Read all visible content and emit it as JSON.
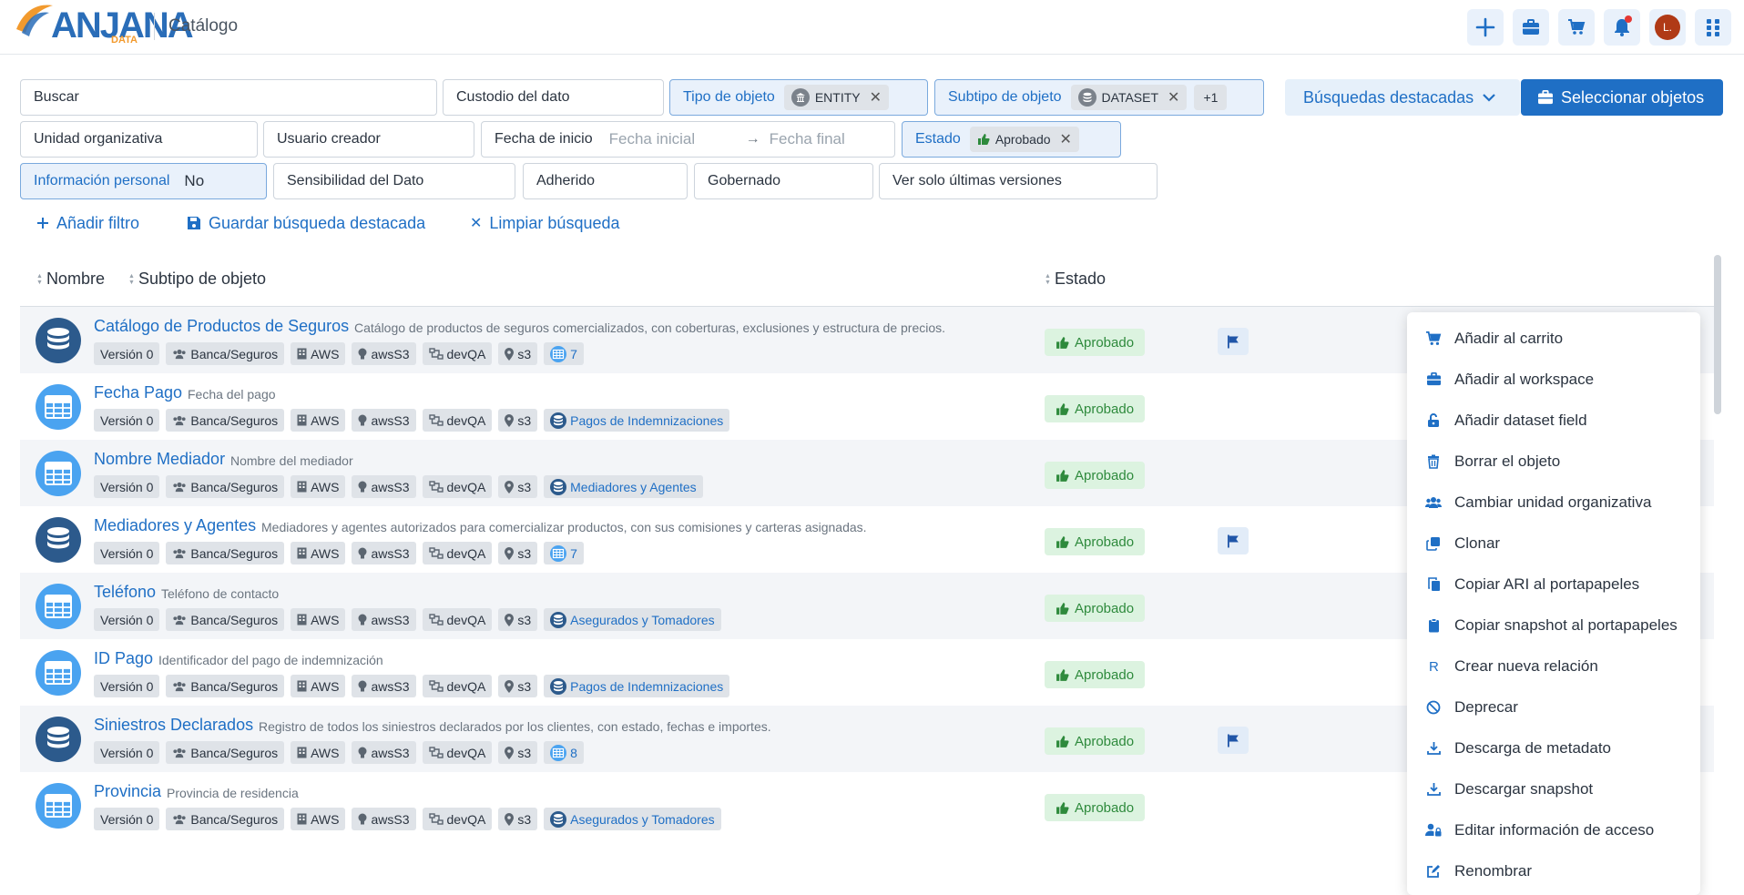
{
  "header": {
    "logo_text": "ANJANA",
    "logo_sub": "DATA",
    "title": "Catálogo",
    "avatar_initial": "L.",
    "colors": {
      "accent": "#1f6fc5",
      "avatar": "#b03a16",
      "notification": "#e53935"
    }
  },
  "filters": {
    "search_label": "Buscar",
    "custodian_label": "Custodio del dato",
    "object_type": {
      "label": "Tipo de objeto",
      "chip": "ENTITY"
    },
    "object_subtype": {
      "label": "Subtipo de objeto",
      "chip": "DATASET",
      "more": "+1"
    },
    "featured_searches": "Búsquedas destacadas",
    "select_objects": "Seleccionar objetos",
    "org_unit_label": "Unidad organizativa",
    "creator_label": "Usuario creador",
    "start_date": {
      "label": "Fecha de inicio",
      "from_placeholder": "Fecha inicial",
      "to_placeholder": "Fecha final"
    },
    "state": {
      "label": "Estado",
      "chip": "Aprobado"
    },
    "personal_info": {
      "label": "Información personal",
      "value": "No"
    },
    "sensitivity_label": "Sensibilidad del Dato",
    "adhered_label": "Adherido",
    "governed_label": "Gobernado",
    "latest_versions_label": "Ver solo últimas versiones"
  },
  "actions": {
    "add_filter": "Añadir filtro",
    "save_search": "Guardar búsqueda destacada",
    "clear_search": "Limpiar búsqueda"
  },
  "table": {
    "columns": {
      "name": "Nombre",
      "subtype": "Subtipo de objeto",
      "state": "Estado"
    },
    "rows": [
      {
        "kind": "dataset",
        "title": "Catálogo de Productos de Seguros",
        "desc": "Catálogo de productos de seguros comercializados, con coberturas, exclusiones y estructura de precios.",
        "version": "Versión 0",
        "org": "Banca/Seguros",
        "provider": "AWS",
        "tech": "awsS3",
        "env": "devQA",
        "location": "s3",
        "related": "7",
        "status": "Aprobado",
        "flag": true
      },
      {
        "kind": "table",
        "title": "Fecha Pago",
        "desc": "Fecha del pago",
        "version": "Versión 0",
        "org": "Banca/Seguros",
        "provider": "AWS",
        "tech": "awsS3",
        "env": "devQA",
        "location": "s3",
        "related": "Pagos de Indemnizaciones",
        "status": "Aprobado",
        "flag": false
      },
      {
        "kind": "table",
        "title": "Nombre Mediador",
        "desc": "Nombre del mediador",
        "version": "Versión 0",
        "org": "Banca/Seguros",
        "provider": "AWS",
        "tech": "awsS3",
        "env": "devQA",
        "location": "s3",
        "related": "Mediadores y Agentes",
        "status": "Aprobado",
        "flag": false
      },
      {
        "kind": "dataset",
        "title": "Mediadores y Agentes",
        "desc": "Mediadores y agentes autorizados para comercializar productos, con sus comisiones y carteras asignadas.",
        "version": "Versión 0",
        "org": "Banca/Seguros",
        "provider": "AWS",
        "tech": "awsS3",
        "env": "devQA",
        "location": "s3",
        "related": "7",
        "status": "Aprobado",
        "flag": true
      },
      {
        "kind": "table",
        "title": "Teléfono",
        "desc": "Teléfono de contacto",
        "version": "Versión 0",
        "org": "Banca/Seguros",
        "provider": "AWS",
        "tech": "awsS3",
        "env": "devQA",
        "location": "s3",
        "related": "Asegurados y Tomadores",
        "status": "Aprobado",
        "flag": false
      },
      {
        "kind": "table",
        "title": "ID Pago",
        "desc": "Identificador del pago de indemnización",
        "version": "Versión 0",
        "org": "Banca/Seguros",
        "provider": "AWS",
        "tech": "awsS3",
        "env": "devQA",
        "location": "s3",
        "related": "Pagos de Indemnizaciones",
        "status": "Aprobado",
        "flag": false
      },
      {
        "kind": "dataset",
        "title": "Siniestros Declarados",
        "desc": "Registro de todos los siniestros declarados por los clientes, con estado, fechas e importes.",
        "version": "Versión 0",
        "org": "Banca/Seguros",
        "provider": "AWS",
        "tech": "awsS3",
        "env": "devQA",
        "location": "s3",
        "related": "8",
        "status": "Aprobado",
        "flag": true
      },
      {
        "kind": "table",
        "title": "Provincia",
        "desc": "Provincia de residencia",
        "version": "Versión 0",
        "org": "Banca/Seguros",
        "provider": "AWS",
        "tech": "awsS3",
        "env": "devQA",
        "location": "s3",
        "related": "Asegurados y Tomadores",
        "status": "Aprobado",
        "flag": false
      }
    ]
  },
  "context_menu": {
    "items": [
      {
        "label": "Añadir al carrito",
        "icon": "cart-icon"
      },
      {
        "label": "Añadir al workspace",
        "icon": "briefcase-icon"
      },
      {
        "label": "Añadir dataset field",
        "icon": "unlock-icon"
      },
      {
        "label": "Borrar el objeto",
        "icon": "trash-icon"
      },
      {
        "label": "Cambiar unidad organizativa",
        "icon": "users-icon"
      },
      {
        "label": "Clonar",
        "icon": "clone-icon"
      },
      {
        "label": "Copiar ARI al portapapeles",
        "icon": "copy-icon"
      },
      {
        "label": "Copiar snapshot al portapapeles",
        "icon": "clipboard-icon"
      },
      {
        "label": "Crear nueva relación",
        "icon": "relation-icon"
      },
      {
        "label": "Deprecar",
        "icon": "ban-icon"
      },
      {
        "label": "Descarga de metadato",
        "icon": "download-icon"
      },
      {
        "label": "Descargar snapshot",
        "icon": "download-icon"
      },
      {
        "label": "Editar información de acceso",
        "icon": "user-lock-icon"
      },
      {
        "label": "Renombrar",
        "icon": "edit-icon"
      }
    ]
  }
}
